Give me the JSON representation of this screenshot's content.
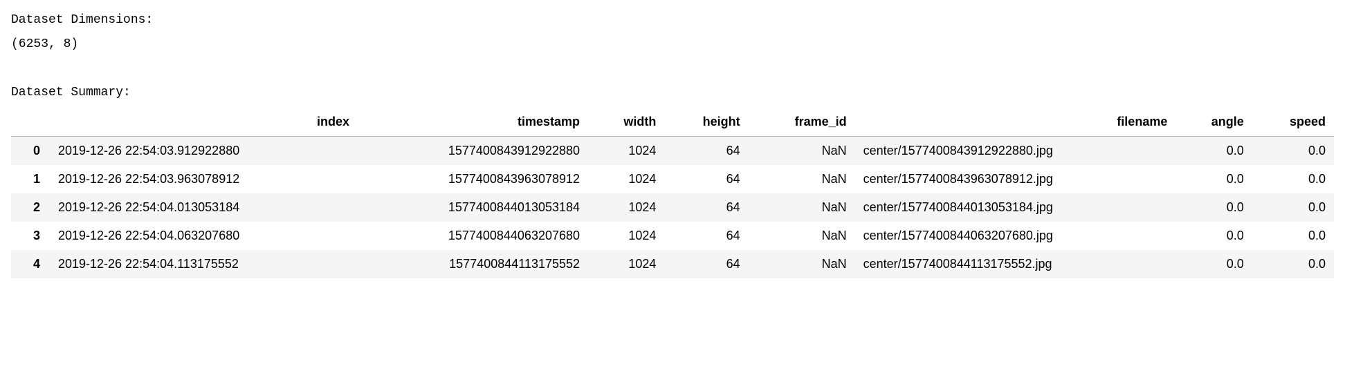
{
  "preamble": {
    "dimensions_label": "Dataset Dimensions:",
    "dimensions_value": "(6253, 8)",
    "summary_label": "Dataset Summary:"
  },
  "table": {
    "columns": [
      "index",
      "timestamp",
      "width",
      "height",
      "frame_id",
      "filename",
      "angle",
      "speed"
    ],
    "rows": [
      {
        "rowidx": "0",
        "cells": [
          "2019-12-26 22:54:03.912922880",
          "1577400843912922880",
          "1024",
          "64",
          "NaN",
          "center/1577400843912922880.jpg",
          "0.0",
          "0.0"
        ]
      },
      {
        "rowidx": "1",
        "cells": [
          "2019-12-26 22:54:03.963078912",
          "1577400843963078912",
          "1024",
          "64",
          "NaN",
          "center/1577400843963078912.jpg",
          "0.0",
          "0.0"
        ]
      },
      {
        "rowidx": "2",
        "cells": [
          "2019-12-26 22:54:04.013053184",
          "1577400844013053184",
          "1024",
          "64",
          "NaN",
          "center/1577400844013053184.jpg",
          "0.0",
          "0.0"
        ]
      },
      {
        "rowidx": "3",
        "cells": [
          "2019-12-26 22:54:04.063207680",
          "1577400844063207680",
          "1024",
          "64",
          "NaN",
          "center/1577400844063207680.jpg",
          "0.0",
          "0.0"
        ]
      },
      {
        "rowidx": "4",
        "cells": [
          "2019-12-26 22:54:04.113175552",
          "1577400844113175552",
          "1024",
          "64",
          "NaN",
          "center/1577400844113175552.jpg",
          "0.0",
          "0.0"
        ]
      }
    ]
  }
}
